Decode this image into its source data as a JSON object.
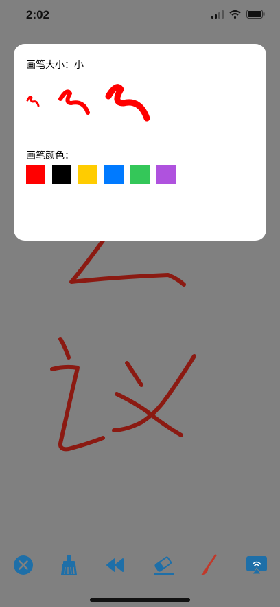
{
  "status_bar": {
    "time": "2:02",
    "icons": [
      "signal-icon",
      "wifi-icon",
      "battery-icon"
    ]
  },
  "pen_panel": {
    "size_label": "画笔大小：",
    "size_value": "小",
    "size_options": [
      "small",
      "medium",
      "large"
    ],
    "color_label": "画笔颜色：",
    "colors": [
      {
        "name": "red",
        "hex": "#FF0000"
      },
      {
        "name": "black",
        "hex": "#000000"
      },
      {
        "name": "yellow",
        "hex": "#FFCC00"
      },
      {
        "name": "blue",
        "hex": "#007AFF"
      },
      {
        "name": "green",
        "hex": "#34C759"
      },
      {
        "name": "purple",
        "hex": "#AF52DE"
      }
    ]
  },
  "toolbar": {
    "tools": [
      "close-icon",
      "clear-brush-icon",
      "undo-icon",
      "eraser-icon",
      "paintbrush-icon",
      "airplay-icon"
    ],
    "accent_color": "#1E6FA8"
  },
  "drawing": {
    "stroke_color": "#8B1A12"
  }
}
